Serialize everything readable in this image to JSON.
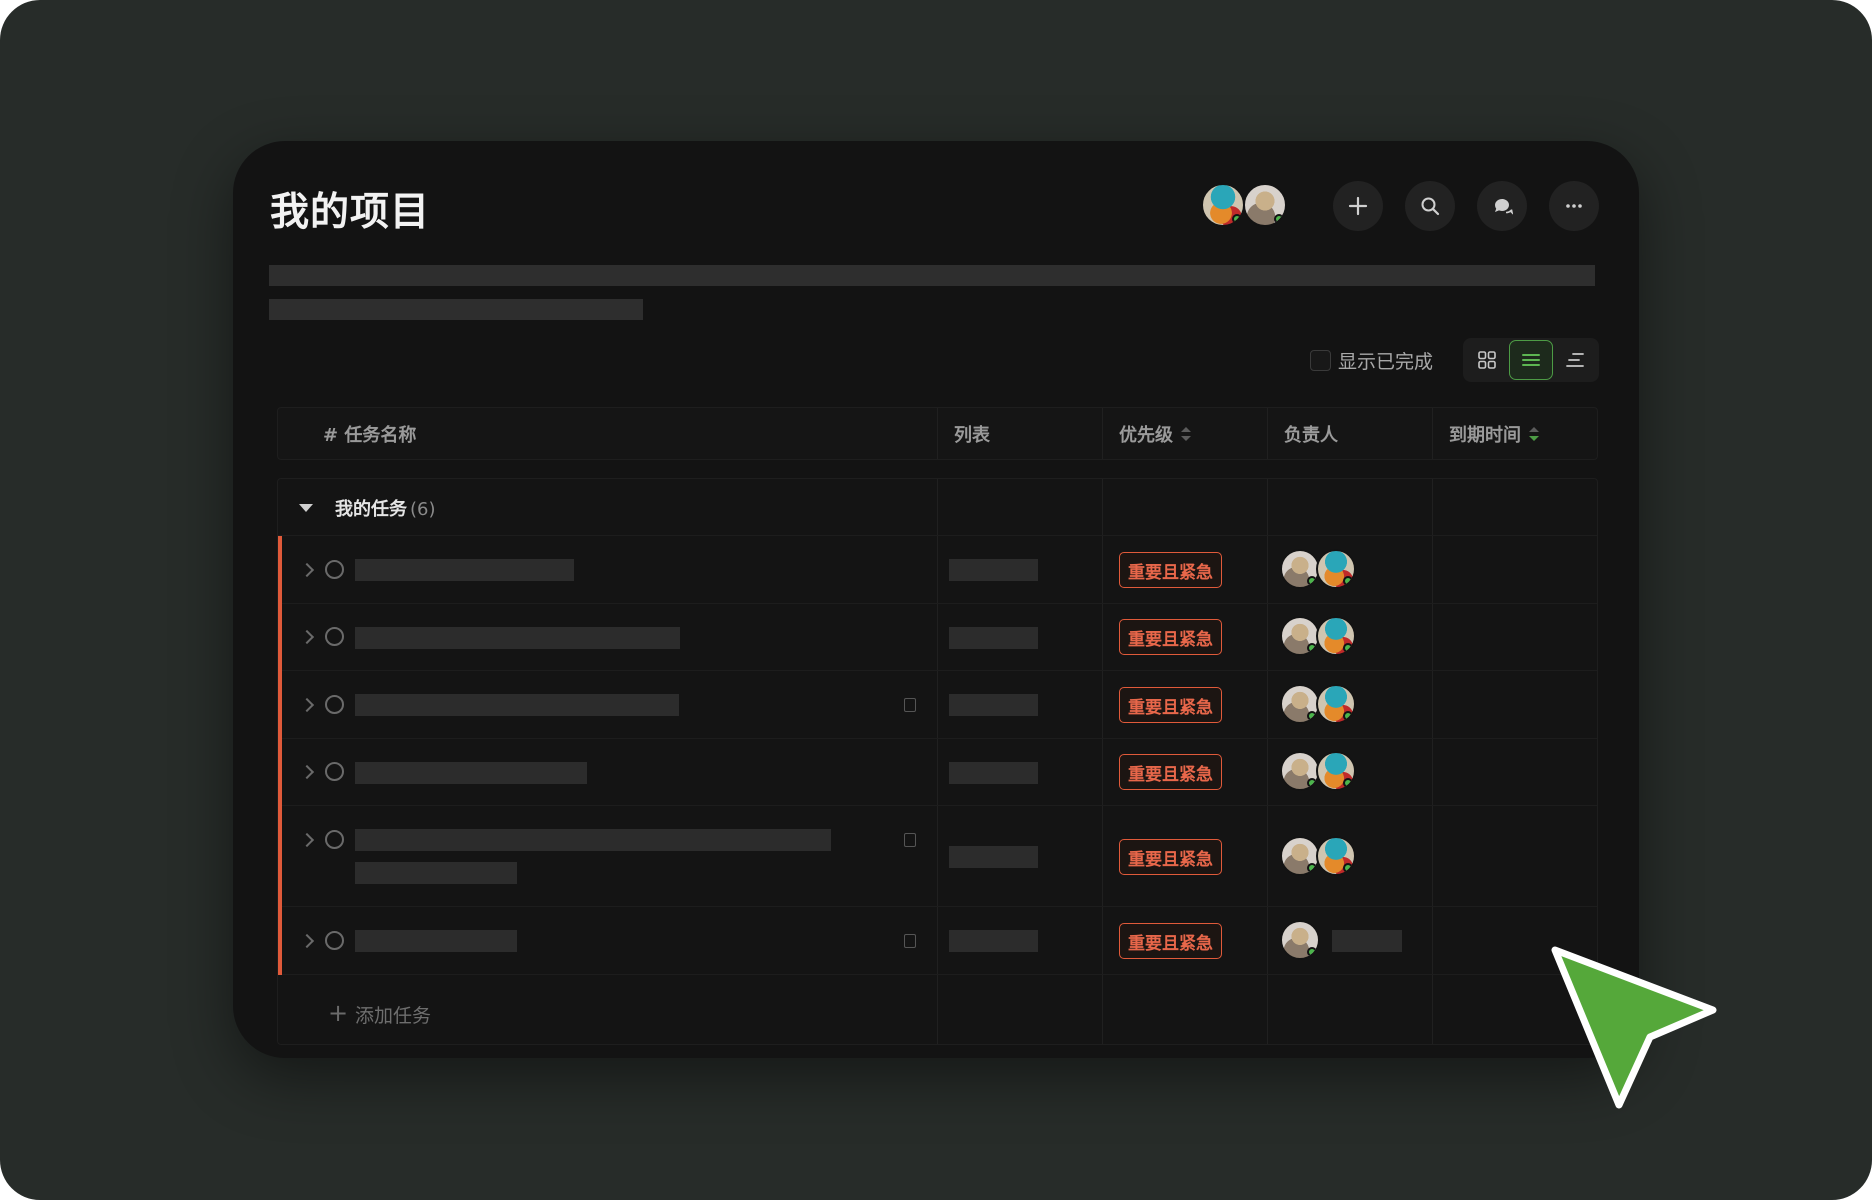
{
  "header": {
    "title": "我的项目",
    "actions": [
      {
        "name": "add",
        "icon": "plus-icon"
      },
      {
        "name": "search",
        "icon": "search-icon"
      },
      {
        "name": "chat",
        "icon": "chat-bubbles-icon"
      },
      {
        "name": "more",
        "icon": "ellipsis-icon"
      }
    ]
  },
  "toolbar": {
    "show_completed_label": "显示已完成",
    "show_completed": false,
    "views": [
      {
        "name": "board",
        "icon": "grid-icon",
        "active": false
      },
      {
        "name": "list",
        "icon": "list-icon",
        "active": true
      },
      {
        "name": "gantt",
        "icon": "gantt-icon",
        "active": false
      }
    ]
  },
  "table": {
    "columns": {
      "task_name": "# 任务名称",
      "list": "列表",
      "priority": "优先级",
      "assignee": "负责人",
      "due": "到期时间"
    },
    "group": {
      "label": "我的任务",
      "count": "(6)"
    },
    "rows": [
      {
        "priority": "重要且紧急",
        "assignees": 2
      },
      {
        "priority": "重要且紧急",
        "assignees": 2
      },
      {
        "priority": "重要且紧急",
        "assignees": 2
      },
      {
        "priority": "重要且紧急",
        "assignees": 2
      },
      {
        "priority": "重要且紧急",
        "assignees": 2
      },
      {
        "priority": "重要且紧急",
        "assignees": 1
      }
    ],
    "add_task_label": "添加任务"
  },
  "colors": {
    "accent_red": "#e05a3a",
    "accent_green": "#4d9b45",
    "cursor_green": "#55a83a"
  }
}
